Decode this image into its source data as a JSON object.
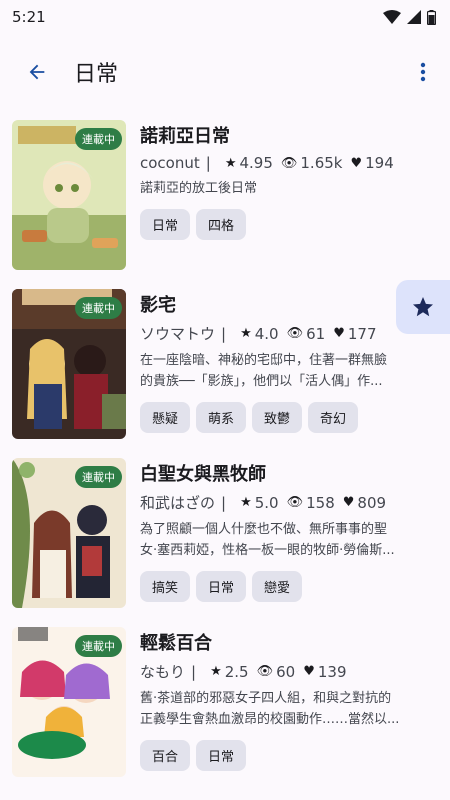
{
  "status": {
    "time": "5:21"
  },
  "header": {
    "title": "日常"
  },
  "items": [
    {
      "title": "諾莉亞日常",
      "badge": "連載中",
      "author": "coconut",
      "rating": "4.95",
      "views": "1.65k",
      "likes": "194",
      "desc": [
        "諾莉亞的放工後日常"
      ],
      "tags": [
        "日常",
        "四格"
      ]
    },
    {
      "title": "影宅",
      "badge": "連載中",
      "author": "ソウマトウ",
      "rating": "4.0",
      "views": "61",
      "likes": "177",
      "desc": [
        "在一座陰暗、神秘的宅邸中，住著一群無臉",
        "的貴族──「影族」，他們以「活人偶」作..."
      ],
      "tags": [
        "懸疑",
        "萌系",
        "致鬱",
        "奇幻"
      ]
    },
    {
      "title": "白聖女與黑牧師",
      "badge": "連載中",
      "author": "和武はざの",
      "rating": "5.0",
      "views": "158",
      "likes": "809",
      "desc": [
        "為了照顧一個人什麼也不做、無所事事的聖",
        "女·塞西莉婭，性格一板一眼的牧師·勞倫斯..."
      ],
      "tags": [
        "搞笑",
        "日常",
        "戀愛"
      ]
    },
    {
      "title": "輕鬆百合",
      "badge": "連載中",
      "author": "なもり",
      "rating": "2.5",
      "views": "60",
      "likes": "139",
      "desc": [
        "舊·茶道部的邪惡女子四人組，和與之對抗的",
        "正義學生會熱血激昂的校園動作……當然以..."
      ],
      "tags": [
        "百合",
        "日常"
      ]
    }
  ],
  "colors": {
    "accent": "#1a4ea1",
    "badge": "#2e7d46",
    "fab": "#dde3fb",
    "fab_icon": "#1d2a5a"
  }
}
